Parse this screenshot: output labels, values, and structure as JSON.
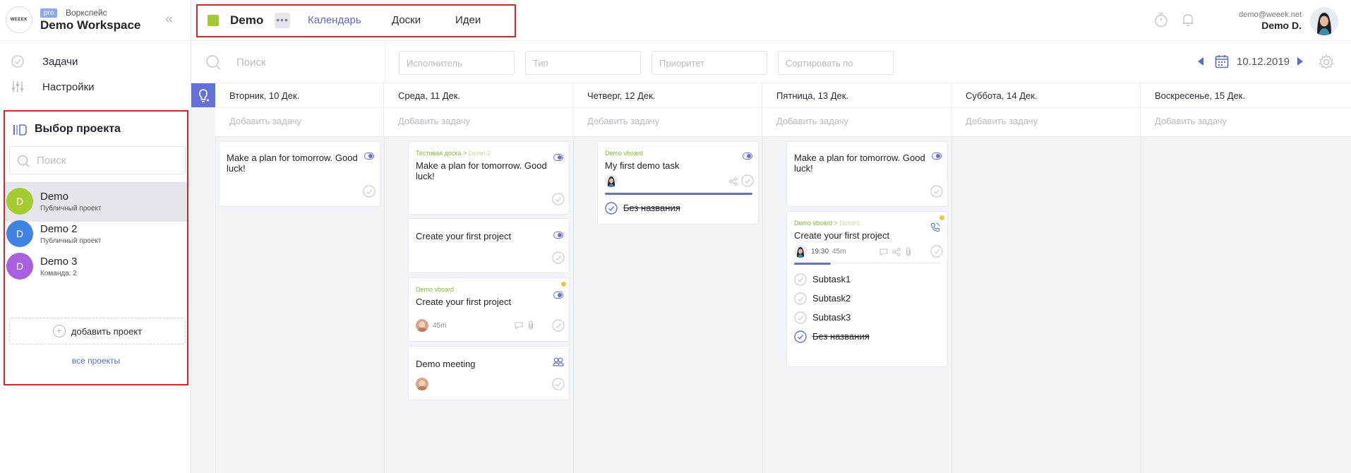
{
  "workspace": {
    "logo_text": "WEEEK",
    "badge": "pro",
    "type_label": "Воркспейс",
    "name": "Demo Workspace"
  },
  "nav": {
    "tasks": "Задачи",
    "settings": "Настройки"
  },
  "project_picker": {
    "title": "Выбор проекта",
    "search_placeholder": "Поиск",
    "projects": [
      {
        "initial": "D",
        "name": "Demo",
        "subtitle": "Публичный проект",
        "color": "#a4cc2f"
      },
      {
        "initial": "D",
        "name": "Demo 2",
        "subtitle": "Публичный проект",
        "color": "#3f83e4"
      },
      {
        "initial": "D",
        "name": "Demo 3",
        "subtitle": "Команда: 2",
        "color": "#a85fe0"
      }
    ],
    "add_label": "добавить проект",
    "all_label": "все проекты"
  },
  "topbar": {
    "project_name": "Demo",
    "project_color": "#a4cc2f",
    "tabs": [
      "Календарь",
      "Доски",
      "Идеи"
    ],
    "user_email": "demo@weeek.net",
    "user_name": "Demo D."
  },
  "filters": {
    "search_placeholder": "Поиск",
    "assignee_placeholder": "Исполнитель",
    "type_placeholder": "Тип",
    "priority_placeholder": "Приоритет",
    "sort_placeholder": "Сортировать по",
    "date": "10.12.2019"
  },
  "calendar": {
    "add_task_label": "Добавить задачу",
    "days": [
      "Вторник, 10 Дек.",
      "Среда, 11 Дек.",
      "Четверг, 12 Дек.",
      "Пятница, 13 Дек.",
      "Суббота, 14 Дек.",
      "Воскресенье, 15 Дек."
    ],
    "cards": {
      "tue_1": {
        "title": "Make a plan for tomorrow. Good luck!"
      },
      "wed_1": {
        "crumb_board": "Тестовая доска",
        "crumb_sep": ">",
        "crumb_col": "Demo 2",
        "title": "Make a plan for tomorrow. Good luck!"
      },
      "wed_2": {
        "title": "Create your first project"
      },
      "wed_3": {
        "crumb": "Demo vboard",
        "title": "Create your first project",
        "duration": "45m"
      },
      "wed_4": {
        "title": "Demo meeting"
      },
      "thu_1": {
        "crumb": "Demo vboard",
        "title": "My first demo task",
        "subtask": "Без названия",
        "progress": 1.0
      },
      "fri_1": {
        "title": "Make a plan for tomorrow. Good luck!"
      },
      "fri_2": {
        "crumb_board": "Demo vboard",
        "crumb_sep": ">",
        "crumb_col": "Demo1",
        "title": "Create your first project",
        "time": "19:30",
        "duration": "45m",
        "progress": 0.25,
        "subtasks": [
          "Subtask1",
          "Subtask2",
          "Subtask3",
          "Без названия"
        ]
      }
    }
  },
  "colors": {
    "accent": "#5a6ad6",
    "highlight": "#e32222",
    "breadcrumb": "#7cbd2b"
  }
}
